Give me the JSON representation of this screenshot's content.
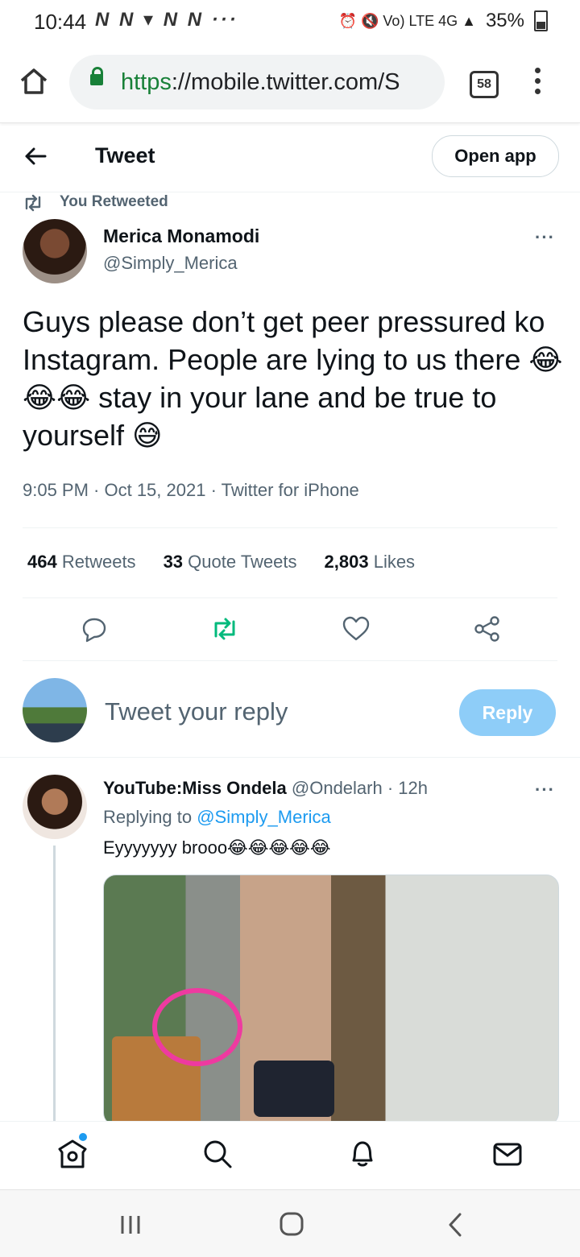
{
  "status_bar": {
    "time": "10:44",
    "notification_icons": "N N ▾ N N ···",
    "right_icons": "⏰ 🔇 Vo) LTE 4G ▲",
    "battery": "35%"
  },
  "browser": {
    "url_scheme": "https",
    "url_rest": "://mobile.twitter.com/S",
    "tab_count": "58"
  },
  "header": {
    "title": "Tweet",
    "open_app": "Open app"
  },
  "tweet": {
    "retweet_context": "You Retweeted",
    "author_name": "Merica Monamodi",
    "author_handle": "@Simply_Merica",
    "text": "Guys please don’t get peer pressured ko Instagram. People are lying to us there 😂😂😂 stay in your lane and be true to yourself 😅",
    "meta": "9:05 PM · Oct 15, 2021 · Twitter for iPhone",
    "stats": {
      "retweets_count": "464",
      "retweets_label": "Retweets",
      "quotes_count": "33",
      "quotes_label": "Quote Tweets",
      "likes_count": "2,803",
      "likes_label": "Likes"
    },
    "more": "···"
  },
  "reply_composer": {
    "placeholder": "Tweet your reply",
    "button": "Reply"
  },
  "reply": {
    "author_name": "YouTube:Miss Ondela",
    "author_handle": "@Ondelarh",
    "time": "· 12h",
    "replying_prefix": "Replying to",
    "replying_to": "@Simply_Merica",
    "text": "Eyyyyyyy brooo😂😂😂😂😂",
    "more": "···"
  },
  "colors": {
    "accent": "#1d9bf0",
    "retweet_green": "#00ba7c",
    "secondary_text": "#536471",
    "reply_button": "#8ecdf8"
  },
  "icons": [
    "back-arrow-icon",
    "home-icon",
    "lock-icon",
    "retweet-icon",
    "reply-icon",
    "like-icon",
    "share-icon",
    "search-icon",
    "notifications-icon",
    "messages-icon"
  ]
}
